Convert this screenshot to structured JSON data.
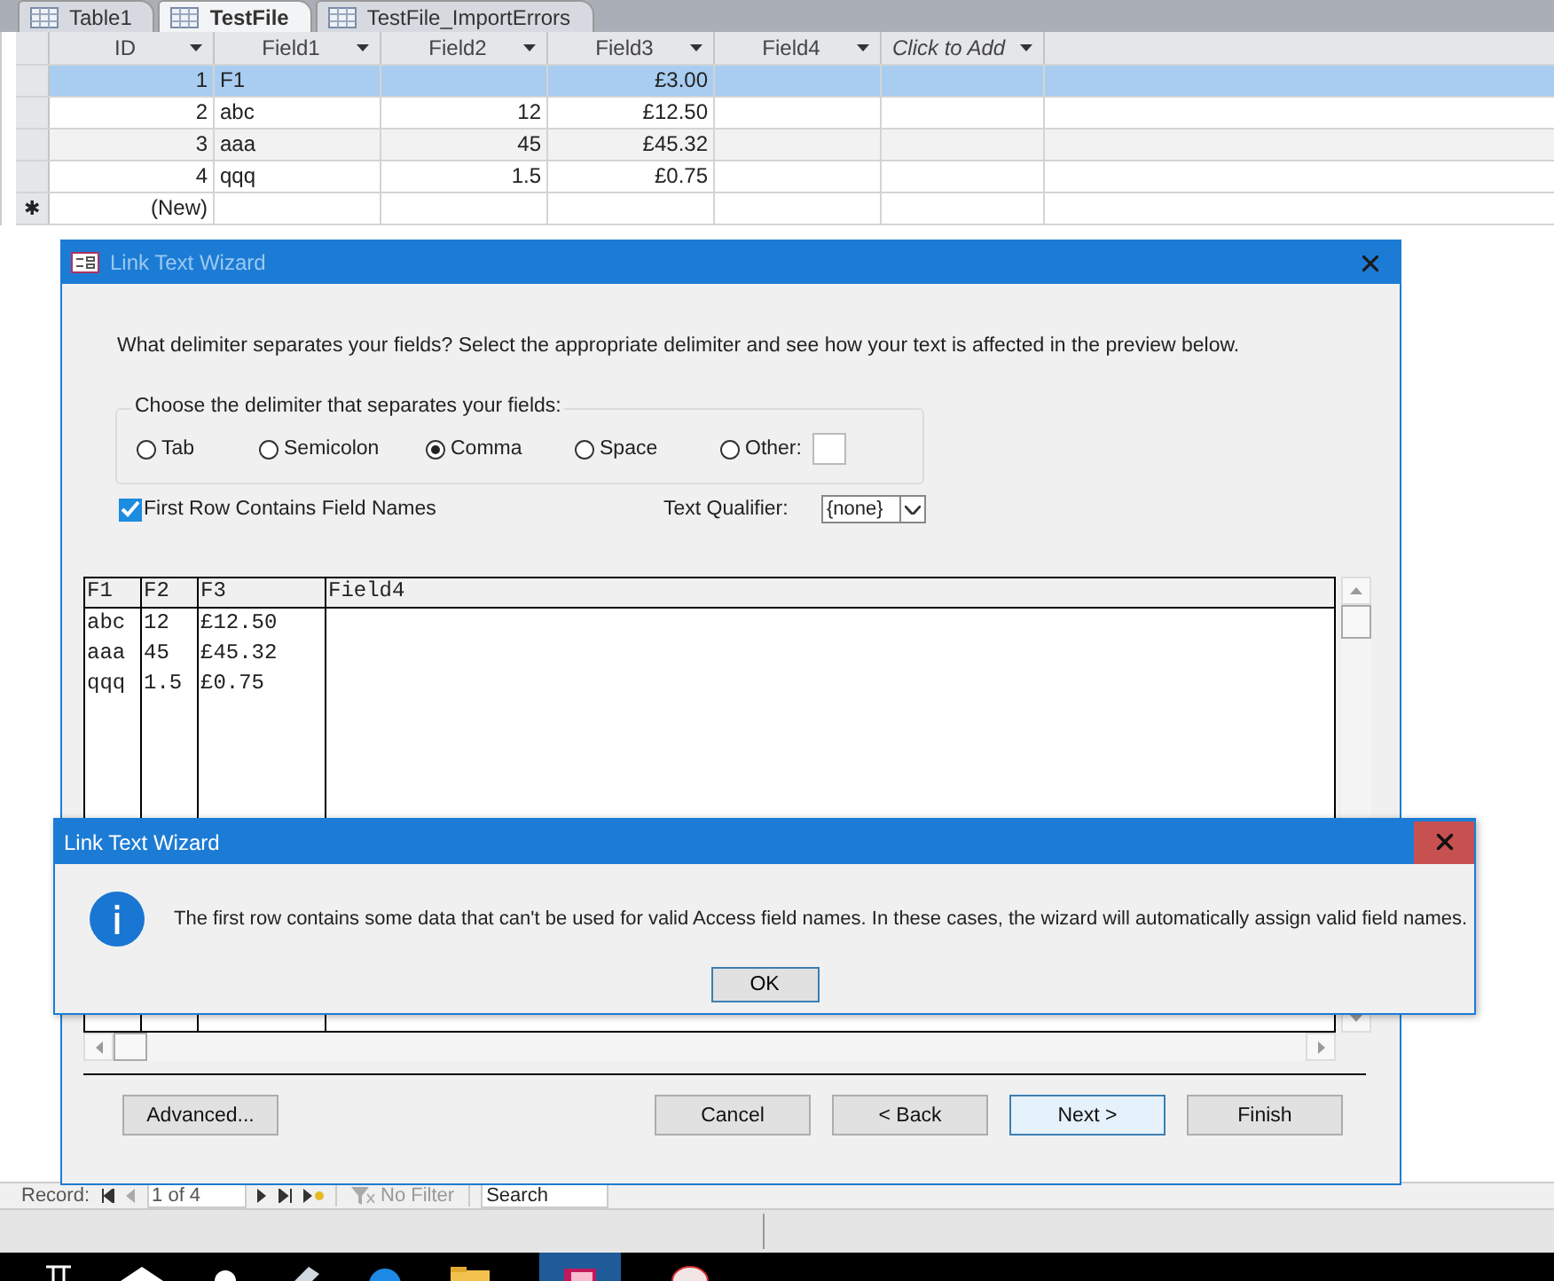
{
  "tabs": [
    {
      "label": "Table1",
      "selected": false
    },
    {
      "label": "TestFile",
      "selected": true
    },
    {
      "label": "TestFile_ImportErrors",
      "selected": false
    }
  ],
  "datasheet": {
    "columns": [
      {
        "label": "ID",
        "italic": false
      },
      {
        "label": "Field1",
        "italic": false
      },
      {
        "label": "Field2",
        "italic": false
      },
      {
        "label": "Field3",
        "italic": false
      },
      {
        "label": "Field4",
        "italic": false
      },
      {
        "label": "Click to Add",
        "italic": true
      }
    ],
    "rows": [
      {
        "selected": true,
        "cells": [
          "1",
          "F1",
          "",
          "£3.00",
          "",
          ""
        ]
      },
      {
        "selected": false,
        "cells": [
          "2",
          "abc",
          "12",
          "£12.50",
          "",
          ""
        ]
      },
      {
        "selected": false,
        "cells": [
          "3",
          "aaa",
          "45",
          "£45.32",
          "",
          ""
        ]
      },
      {
        "selected": false,
        "cells": [
          "4",
          "qqq",
          "1.5",
          "£0.75",
          "",
          ""
        ]
      }
    ],
    "new_row": {
      "marker": "✱",
      "id": "(New)"
    }
  },
  "record_nav": {
    "label": "Record:",
    "position": "1 of 4",
    "filter": "No Filter",
    "search": "Search"
  },
  "wizard": {
    "title": "Link Text Wizard",
    "instruction": "What delimiter separates your fields? Select the appropriate delimiter and see how your text is affected in the preview below.",
    "group_label": "Choose the delimiter that separates your fields:",
    "delimiters": [
      {
        "label": "Tab",
        "selected": false
      },
      {
        "label": "Semicolon",
        "selected": false
      },
      {
        "label": "Comma",
        "selected": true
      },
      {
        "label": "Space",
        "selected": false
      },
      {
        "label": "Other:",
        "selected": false
      }
    ],
    "first_row": {
      "label": "First Row Contains Field Names",
      "checked": true
    },
    "text_qualifier": {
      "label": "Text Qualifier:",
      "value": "{none}"
    },
    "preview": {
      "columns": [
        "F1",
        "F2",
        "F3",
        "Field4"
      ],
      "rows": [
        [
          "abc",
          "12",
          "£12.50",
          ""
        ],
        [
          "aaa",
          "45",
          "£45.32",
          ""
        ],
        [
          "qqq",
          "1.5",
          "£0.75",
          ""
        ]
      ]
    },
    "buttons": [
      {
        "label": "Advanced...",
        "default": false
      },
      {
        "label": "Cancel",
        "default": false
      },
      {
        "label": "< Back",
        "default": false
      },
      {
        "label": "Next >",
        "default": true
      },
      {
        "label": "Finish",
        "default": false
      }
    ]
  },
  "message": {
    "title": "Link Text Wizard",
    "text": "The first row contains some data that can't be used for valid Access field names. In these cases, the wizard will automatically assign valid field names.",
    "button": "OK"
  }
}
